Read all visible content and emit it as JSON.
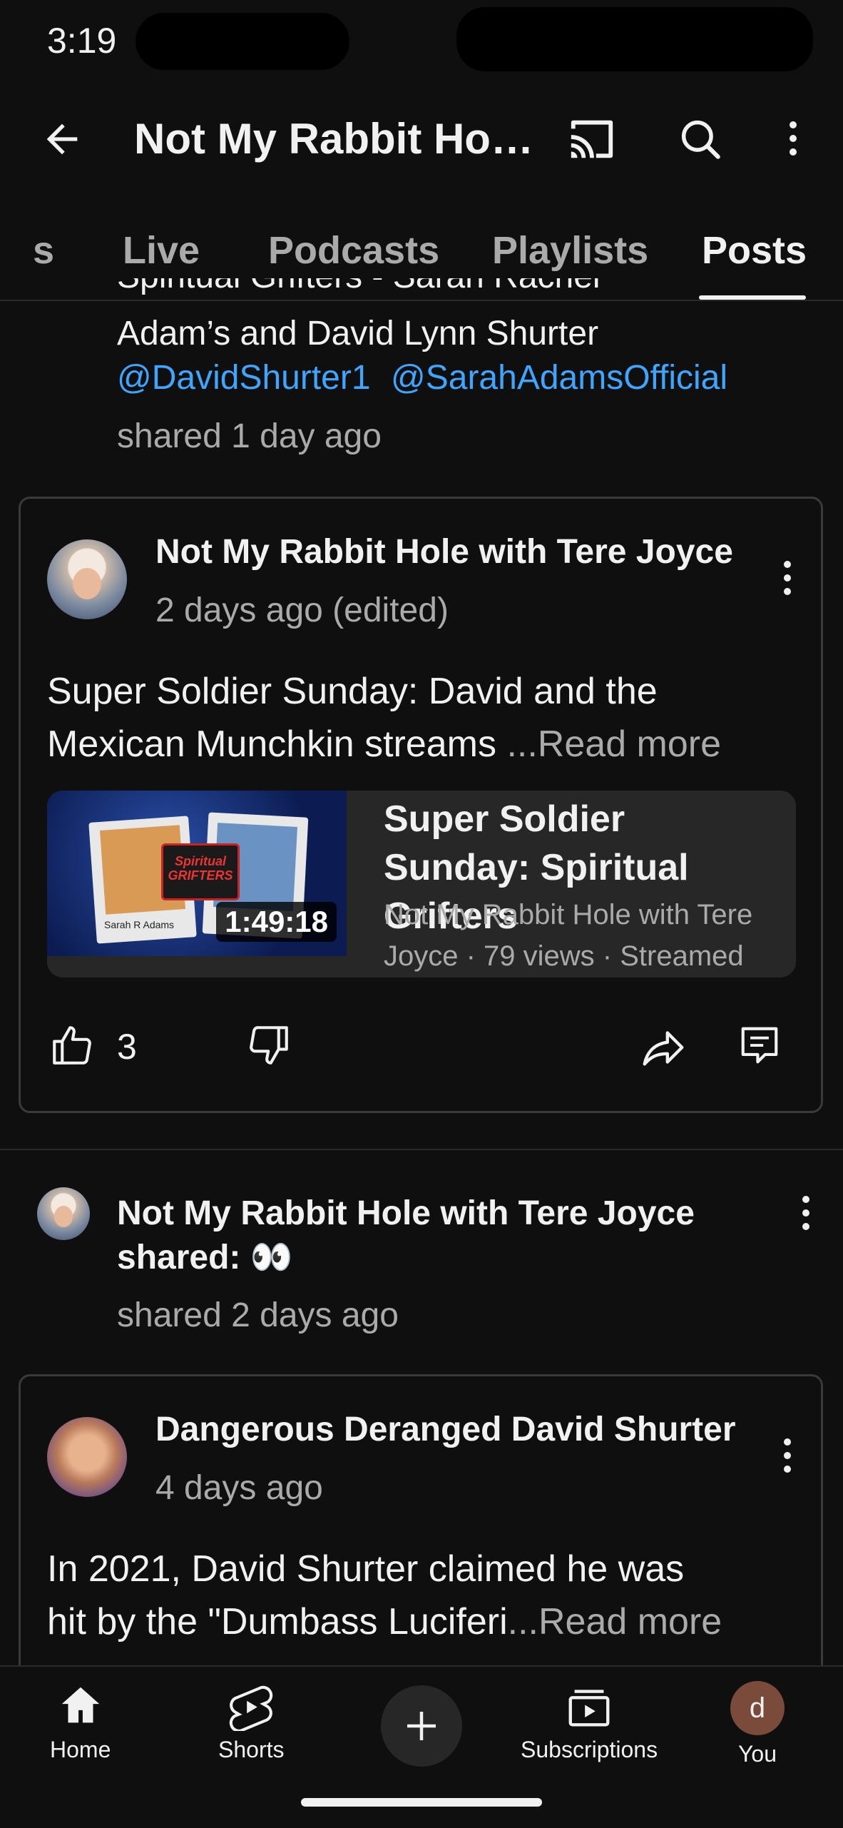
{
  "status_bar": {
    "time": "3:19"
  },
  "header": {
    "title": "Not My Rabbit Hole with Tere Joyce"
  },
  "tabs": [
    {
      "label": "s"
    },
    {
      "label": "Live"
    },
    {
      "label": "Podcasts"
    },
    {
      "label": "Playlists"
    },
    {
      "label": "Posts"
    }
  ],
  "post_top": {
    "partial_line": "Spiritual Grifters - Sarah Rachel",
    "line2": "Adam’s and David Lynn Shurter",
    "mention1": "@DavidShurter1",
    "mention2": "@SarahAdamsOfficial",
    "shared": "shared 1 day ago"
  },
  "post1": {
    "author": "Not My Rabbit Hole with Tere Joyce",
    "time": "2 days ago (edited)",
    "text": "Super Soldier Sunday: David and the Mexican Munchkin streams",
    "read_more": "...Read more",
    "video": {
      "title": "Super Soldier Sunday: Spiritual Grifters",
      "channel_line": "Not My Rabbit Hole with Tere",
      "meta_line": "Joyce  · 79 views · Streamed",
      "duration": "1:49:18",
      "thumb_name": "Sarah R Adams",
      "thumb_badge": "Spiritual GRIFTERS"
    },
    "likes": "3"
  },
  "post2": {
    "author_line1": "Not My Rabbit Hole with Tere Joyce",
    "author_line2": "shared: 👀",
    "shared": "shared 2 days ago"
  },
  "post3": {
    "author": "Dangerous Deranged David Shurter",
    "time": "4 days ago",
    "line1": "In 2021, David Shurter claimed he was",
    "line2": "hit by the \"Dumbass Luciferi",
    "read_more": "...Read more"
  },
  "bottom_nav": {
    "home": "Home",
    "shorts": "Shorts",
    "subscriptions": "Subscriptions",
    "you": "You",
    "you_initial": "d"
  }
}
